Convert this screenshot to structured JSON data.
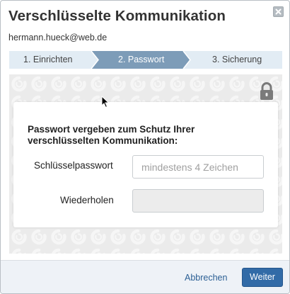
{
  "dialog": {
    "title": "Verschlüsselte Kommunikation",
    "email": "hermann.hueck@web.de"
  },
  "steps": [
    {
      "label": "1. Einrichten",
      "state": "done"
    },
    {
      "label": "2. Passwort",
      "state": "active"
    },
    {
      "label": "3. Sicherung",
      "state": "pending"
    }
  ],
  "form": {
    "heading": "Passwort vergeben zum Schutz Ihrer verschlüsselten Kommunikation:",
    "password_label": "Schlüsselpasswort",
    "password_placeholder": "mindestens 4 Zeichen",
    "password_value": "",
    "repeat_label": "Wiederholen",
    "repeat_value": ""
  },
  "footer": {
    "cancel_label": "Abbrechen",
    "next_label": "Weiter"
  },
  "icons": {
    "close": "close-icon",
    "lock": "lock-icon",
    "cursor": "mouse-cursor-icon"
  },
  "colors": {
    "step_active": "#7d9cb8",
    "step_inactive": "#e2ecf4",
    "primary_button": "#326ba7",
    "link": "#2b5f94"
  }
}
